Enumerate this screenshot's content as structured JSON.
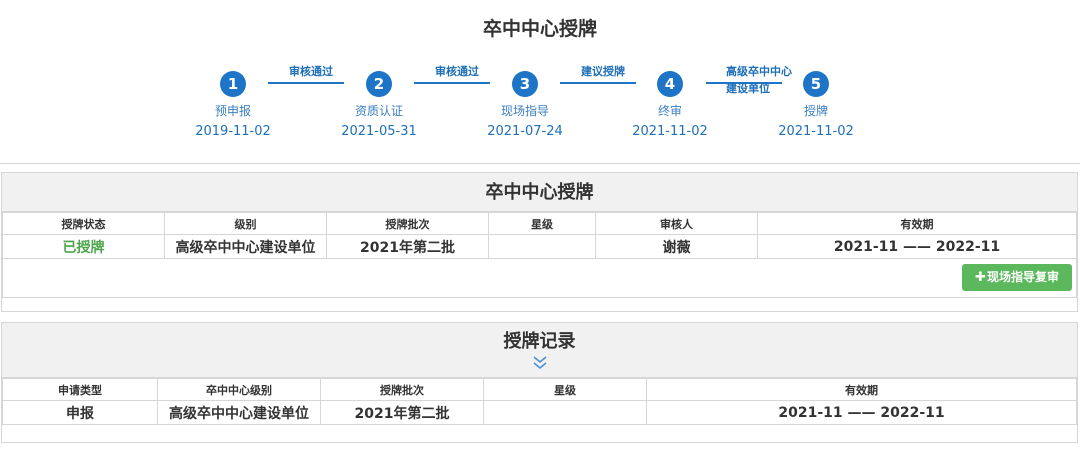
{
  "page": {
    "title": "卒中中心授牌"
  },
  "stepper": {
    "steps": [
      {
        "number": "1",
        "name": "预申报",
        "date": "2019-11-02"
      },
      {
        "number": "2",
        "name": "资质认证",
        "date": "2021-05-31"
      },
      {
        "number": "3",
        "name": "现场指导",
        "date": "2021-07-24"
      },
      {
        "number": "4",
        "name": "终审",
        "date": "2021-11-02"
      },
      {
        "number": "5",
        "name": "授牌",
        "date": "2021-11-02"
      }
    ],
    "connectors": [
      {
        "label": "审核通过"
      },
      {
        "label": "审核通过"
      },
      {
        "label": "建议授牌"
      },
      {
        "label_line1": "高级卒中中心",
        "label_line2": "建设单位"
      }
    ]
  },
  "award_panel": {
    "title": "卒中中心授牌",
    "columns": [
      "授牌状态",
      "级别",
      "授牌批次",
      "星级",
      "审核人",
      "有效期"
    ],
    "row": {
      "status": "已授牌",
      "level": "高级卒中中心建设单位",
      "batch": "2021年第二批",
      "stars": "",
      "reviewer": "谢薇",
      "validity": "2021-11 —— 2022-11"
    },
    "action_button": {
      "icon": "plus-icon",
      "label": "现场指导复审"
    },
    "status_color": "#4ca54c"
  },
  "records_panel": {
    "title": "授牌记录",
    "columns": [
      "申请类型",
      "卒中中心级别",
      "授牌批次",
      "星级",
      "有效期"
    ],
    "rows": [
      {
        "type": "申报",
        "level": "高级卒中中心建设单位",
        "batch": "2021年第二批",
        "stars": "",
        "validity": "2021-11 —— 2022-11"
      }
    ]
  },
  "colors": {
    "accent": "#1e74c6",
    "button_green": "#5cb85c",
    "header_bg": "#f1f1f1"
  }
}
